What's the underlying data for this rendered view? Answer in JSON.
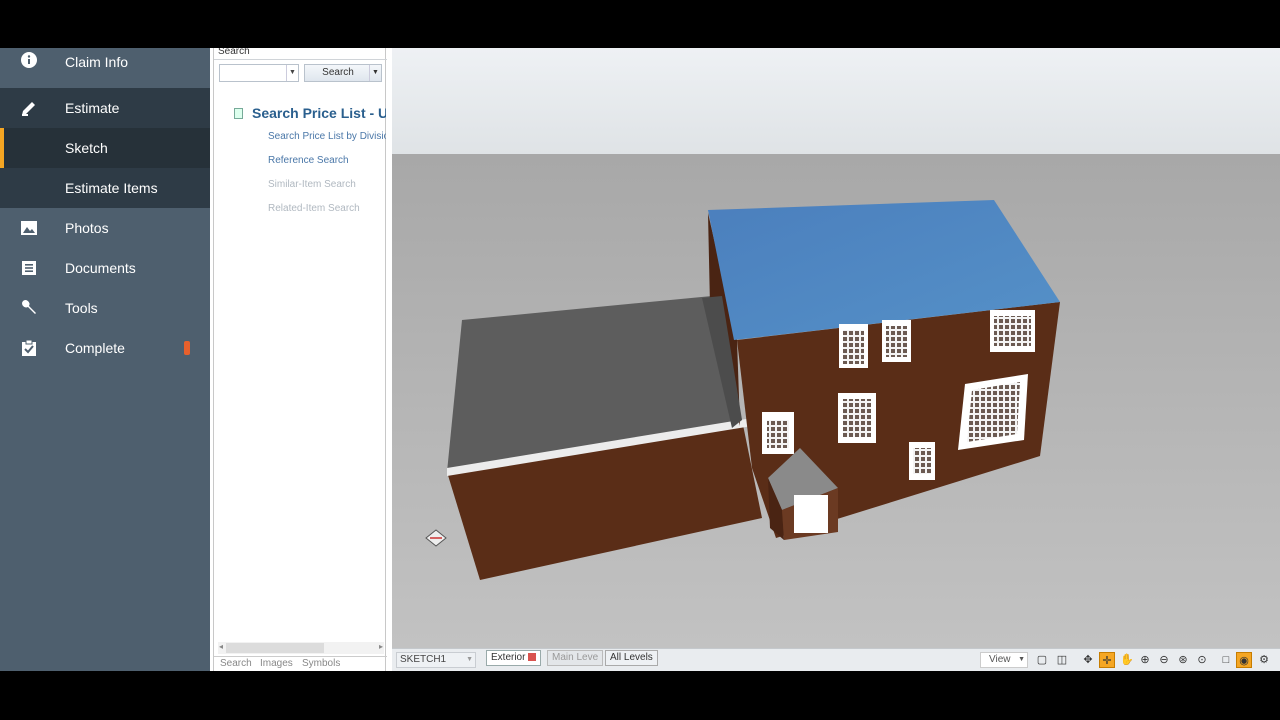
{
  "sidebar": {
    "items": [
      {
        "label": "Claim Info",
        "icon": "info-icon"
      },
      {
        "label": "Estimate",
        "icon": "edit-icon"
      },
      {
        "label": "Sketch",
        "icon": ""
      },
      {
        "label": "Estimate Items",
        "icon": ""
      },
      {
        "label": "Photos",
        "icon": "image-icon"
      },
      {
        "label": "Documents",
        "icon": "document-icon"
      },
      {
        "label": "Tools",
        "icon": "wrench-icon"
      },
      {
        "label": "Complete",
        "icon": "clipboard-check-icon"
      }
    ],
    "colors": {
      "bg": "#4e5f6e",
      "active": "#2e3b46",
      "accent": "#f5a623",
      "alert": "#e8602c"
    }
  },
  "search_panel": {
    "title": "Search",
    "search_button": "Search",
    "tree_head": "Search Price List - UT",
    "links": [
      "Search Price List by Divisio",
      "Reference Search",
      "Similar-Item Search",
      "Related-Item Search"
    ],
    "tabs": [
      "Search",
      "Images",
      "Symbols"
    ]
  },
  "statusbar": {
    "sketch_select": "SKETCH1",
    "level_tabs": [
      "Exterior",
      "Main Leve",
      "All Levels"
    ],
    "view_select": "View"
  },
  "scene": {
    "roof_color": "#4d86c0",
    "wall_color": "#5a2d17",
    "garage_roof_color": "#6b6b6b"
  }
}
